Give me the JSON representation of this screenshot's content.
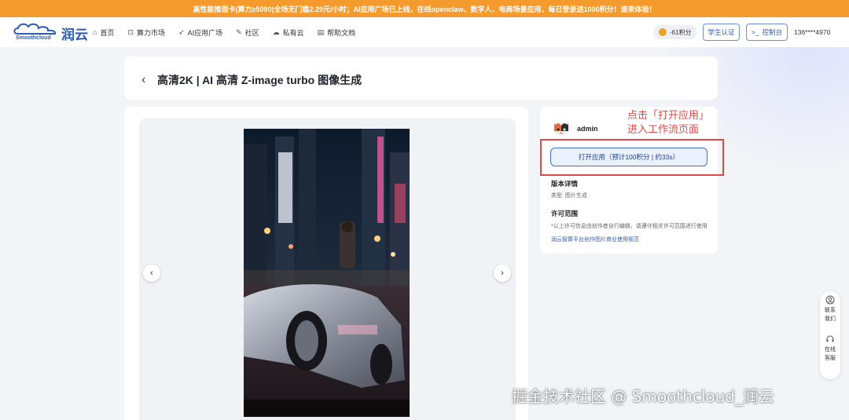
{
  "banner": {
    "text": "高性能推理卡(算力≥5090)全场无门槛2.29元/小时；AI应用广场已上线，在线openclaw、数字人、电商场景应用，每日登录送1000积分！速来体验！"
  },
  "header": {
    "logo_en": "Smoothcloud",
    "logo_cn": "润云",
    "nav": [
      {
        "icon": "home-icon",
        "glyph": "⌂",
        "label": "首页"
      },
      {
        "icon": "cart-icon",
        "glyph": "⊡",
        "label": "算力市场"
      },
      {
        "icon": "rocket-icon",
        "glyph": "➶",
        "label": "AI应用广场"
      },
      {
        "icon": "community-icon",
        "glyph": "✎",
        "label": "社区"
      },
      {
        "icon": "cloud-icon",
        "glyph": "☁",
        "label": "私有云"
      },
      {
        "icon": "doc-icon",
        "glyph": "▤",
        "label": "帮助文档"
      }
    ],
    "points": "-61积分",
    "student_label": "学生认证",
    "console_label": "控制台",
    "console_icon": ">_",
    "user": "136****4970"
  },
  "page": {
    "title": "高清2K | AI 高清 Z-image turbo 图像生成",
    "back_icon": "‹"
  },
  "gallery": {
    "prev_glyph": "‹",
    "next_glyph": "›"
  },
  "side": {
    "author": "admin",
    "open_button": "打开应用（预计100积分 | 约33s）",
    "annotation_line1": "点击「打开应用」",
    "annotation_line2": "进入工作流页面",
    "version_title": "版本详情",
    "version_type": "类型: 图片生成",
    "license_title": "许可范围",
    "license_text": "*以上许可信息由创作者自行编辑，请遵守相关许可范围进行使用",
    "license_link": "润云智算平台创作图片商业使用规范"
  },
  "float": {
    "contact": "联系我们",
    "service": "在线客服"
  },
  "watermark": "掘金技术社区 @ Smoothcloud_润云",
  "colors": {
    "banner": "#f59a2c",
    "brand": "#2a5db0",
    "annotation": "#e04848"
  }
}
